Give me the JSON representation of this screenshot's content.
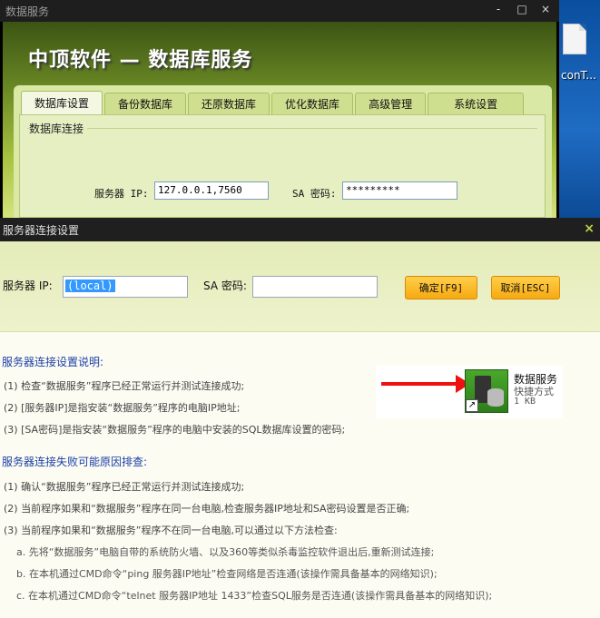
{
  "desktop": {
    "file_label": "conT..."
  },
  "main_window": {
    "title": "数据服务",
    "controls": {
      "minimize": "-",
      "maximize": "□",
      "close": "×"
    },
    "banner": "中顶软件 — 数据库服务",
    "tabs": [
      {
        "label": "数据库设置",
        "active": true
      },
      {
        "label": "备份数据库",
        "active": false
      },
      {
        "label": "还原数据库",
        "active": false
      },
      {
        "label": "优化数据库",
        "active": false
      },
      {
        "label": "高级管理",
        "active": false
      },
      {
        "label": "系统设置",
        "active": false
      }
    ],
    "group_title": "数据库连接",
    "server_ip_label": "服务器 IP:",
    "server_ip_value": "127.0.0.1,7560",
    "sa_password_label": "SA 密码:",
    "sa_password_value": "*********"
  },
  "dialog": {
    "title": "服务器连接设置",
    "close": "×",
    "server_ip_label": "服务器 IP:",
    "server_ip_value": "(local)",
    "sa_password_label": "SA 密码:",
    "sa_password_value": "",
    "ok_button": "确定[F9]",
    "cancel_button": "取消[ESC]",
    "section1_title": "服务器连接设置说明:",
    "section1_items": [
      "(1)  检查“数据服务”程序已经正常运行并测试连接成功;",
      "(2)  [服务器IP]是指安装“数据服务”程序的电脑IP地址;",
      "(3)  [SA密码]是指安装“数据服务”程序的电脑中安装的SQL数据库设置的密码;"
    ],
    "section2_title": "服务器连接失败可能原因排查:",
    "section2_items": [
      "(1)  确认“数据服务”程序已经正常运行并测试连接成功;",
      "(2)  当前程序如果和“数据服务”程序在同一台电脑,检查服务器IP地址和SA密码设置是否正确;",
      "(3)  当前程序如果和“数据服务”程序不在同一台电脑,可以通过以下方法检查:"
    ],
    "section2_subitems": [
      "a.  先将“数据服务”电脑自带的系统防火墙、以及360等类似杀毒监控软件退出后,重新测试连接;",
      "b.  在本机通过CMD命令“ping 服务器IP地址”检查网络是否连通(该操作需具备基本的网络知识);",
      "c.  在本机通过CMD命令“telnet 服务器IP地址 1433”检查SQL服务是否连通(该操作需具备基本的网络知识);"
    ],
    "shortcut": {
      "name": "数据服务",
      "type": "快捷方式",
      "size": "1 KB"
    }
  }
}
